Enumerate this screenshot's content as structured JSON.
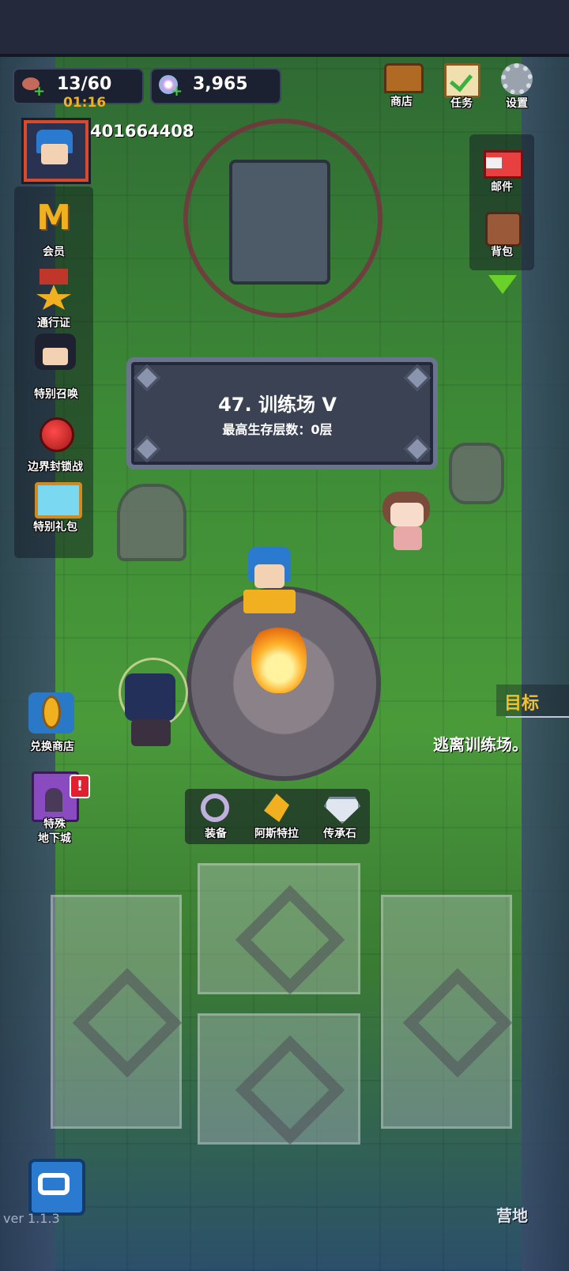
{
  "top_bar": {
    "stamina": {
      "value": "13/60",
      "timer": "01:16"
    },
    "gems": {
      "value": "3,965"
    },
    "buttons": [
      {
        "label": "商店"
      },
      {
        "label": "任务"
      },
      {
        "label": "设置"
      }
    ]
  },
  "player": {
    "id": "401664408"
  },
  "left_menu": [
    {
      "label": "会员"
    },
    {
      "label": "通行证"
    },
    {
      "label": "特别召唤"
    },
    {
      "label": "边界封锁战"
    },
    {
      "label": "特别礼包"
    }
  ],
  "left_menu_lower": [
    {
      "label": "兑换商店"
    },
    {
      "label": "特殊\n地下城"
    }
  ],
  "right_menu": [
    {
      "label": "邮件"
    },
    {
      "label": "背包"
    }
  ],
  "level": {
    "title": "47. 训练场 V",
    "subtitle": "最高生存层数：0层"
  },
  "objective": {
    "header": "目标",
    "text": "逃离训练场。"
  },
  "hero_bar": [
    {
      "label": "装备"
    },
    {
      "label": "阿斯特拉"
    },
    {
      "label": "传承石"
    }
  ],
  "bottom": {
    "camp_label": "营地",
    "version": "ver 1.1.3"
  },
  "colors": {
    "accent_gold": "#f0b020",
    "objective_gold": "#f0c030",
    "notification_red": "#e02030"
  }
}
